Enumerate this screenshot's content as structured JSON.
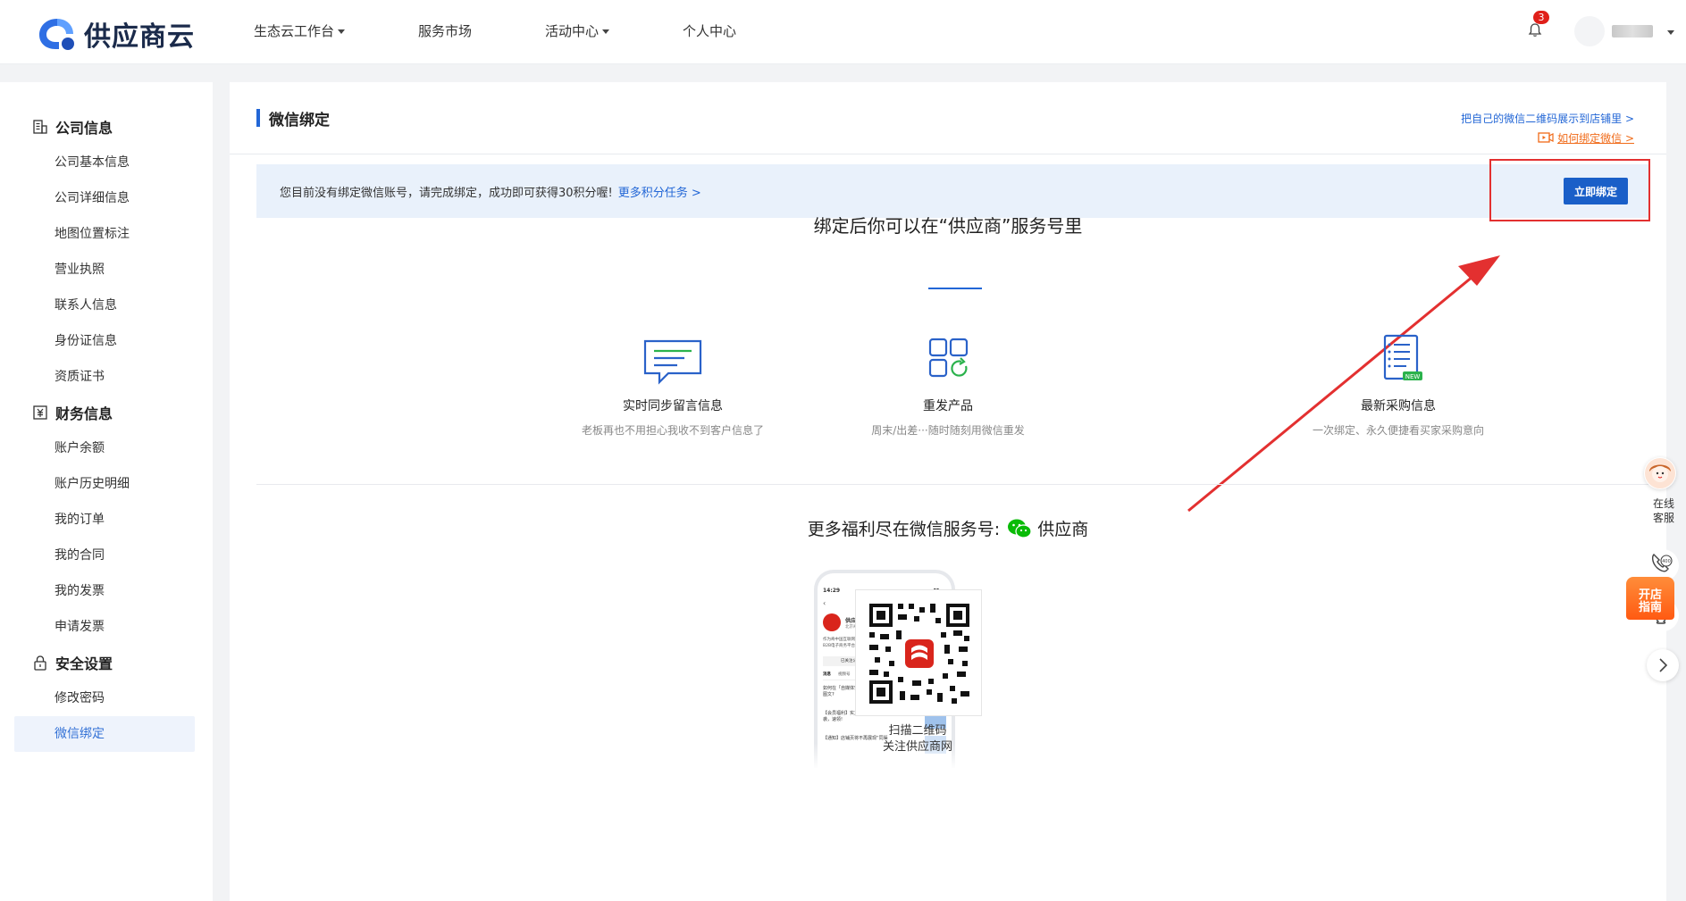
{
  "brand": {
    "name": "供应商云"
  },
  "topnav": {
    "items": [
      {
        "label": "生态云工作台",
        "has_dropdown": true
      },
      {
        "label": "服务市场",
        "has_dropdown": false
      },
      {
        "label": "活动中心",
        "has_dropdown": true
      },
      {
        "label": "个人中心",
        "has_dropdown": false
      }
    ],
    "notification_count": "3"
  },
  "sidebar": {
    "groups": [
      {
        "title": "公司信息",
        "icon": "company-icon",
        "items": [
          "公司基本信息",
          "公司详细信息",
          "地图位置标注",
          "营业执照",
          "联系人信息",
          "身份证信息",
          "资质证书"
        ]
      },
      {
        "title": "财务信息",
        "icon": "finance-icon",
        "items": [
          "账户余额",
          "账户历史明细",
          "我的订单",
          "我的合同",
          "我的发票",
          "申请发票"
        ]
      },
      {
        "title": "安全设置",
        "icon": "lock-icon",
        "items": [
          "修改密码",
          "微信绑定"
        ]
      }
    ],
    "active": "微信绑定"
  },
  "page": {
    "title": "微信绑定",
    "link_show_qr": "把自己的微信二维码展示到店铺里 >",
    "link_how_to_bind": "如何绑定微信 >",
    "notice_text": "您目前没有绑定微信账号，请完成绑定，成功即可获得30积分喔!",
    "notice_link": "更多积分任务 >",
    "bind_button": "立即绑定",
    "benefit_heading": "绑定后你可以在“供应商”服务号里",
    "features": [
      {
        "icon": "message-icon",
        "title": "实时同步留言信息",
        "desc": "老板再也不用担心我收不到客户信息了"
      },
      {
        "icon": "resend-product-icon",
        "title": "重发产品",
        "desc": "周末/出差···随时随刻用微信重发"
      },
      {
        "icon": "purchase-list-icon",
        "title": "最新采购信息",
        "desc": "一次绑定、永久便捷看买家采购意向"
      }
    ],
    "wechat_heading": "更多福利尽在微信服务号:",
    "wechat_account": "供应商",
    "qr_caption_line1": "扫描二维码",
    "qr_caption_line2": "关注供应商网",
    "phone": {
      "time": "14:29",
      "account_name": "供应商",
      "account_org": "北京奇思涌天科技有限公司",
      "intro": "作为奇中国互联网商城中心和北京奇思涌天科技有限公司共同推出的B2B电子商务平台。中国供应商（w…",
      "follow_btn": "已关注公众号",
      "msg_btn": "发消息",
      "tabs": [
        "消息",
        "视频号",
        "服务"
      ],
      "articles": [
        "如何在「自媒体营销生态」发布优质图文?",
        "【会员福利】实力供应商债费福利来袭，速领!",
        "【通知】店铺页将不再展现“同渠"
      ]
    }
  },
  "float_bar": {
    "cs_label_1": "在线",
    "cs_label_2": "客服",
    "guide_1": "开店",
    "guide_2": "指南"
  },
  "colors": {
    "primary": "#1a5fc8",
    "accent_blue": "#2266d6",
    "orange": "#f06a18",
    "annotation_red": "#e33030",
    "wechat_green": "#09bb07"
  }
}
